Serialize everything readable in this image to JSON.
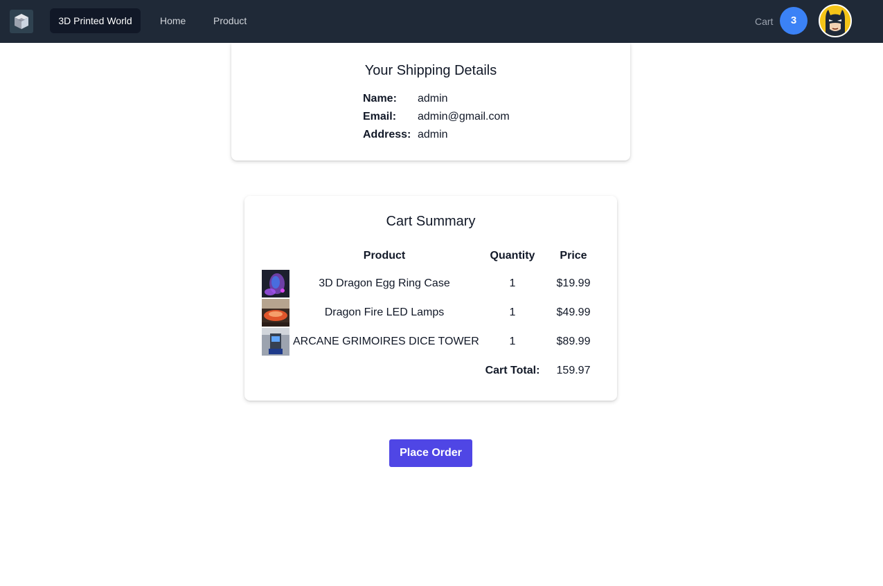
{
  "navbar": {
    "logo_icon": "cube-icon",
    "brand": "3D Printed World",
    "links": [
      "Home",
      "Product"
    ],
    "cart_label": "Cart",
    "cart_count": "3",
    "avatar_icon": "batman-avatar"
  },
  "shipping": {
    "title": "Your Shipping Details",
    "rows": [
      {
        "key": "Name:",
        "value": "admin"
      },
      {
        "key": "Email:",
        "value": "admin@gmail.com"
      },
      {
        "key": "Address:",
        "value": "admin"
      }
    ]
  },
  "cart": {
    "title": "Cart Summary",
    "headers": {
      "product": "Product",
      "quantity": "Quantity",
      "price": "Price"
    },
    "items": [
      {
        "name": "3D Dragon Egg Ring Case",
        "quantity": "1",
        "price": "$19.99"
      },
      {
        "name": "Dragon Fire LED Lamps",
        "quantity": "1",
        "price": "$49.99"
      },
      {
        "name": "ARCANE GRIMOIRES DICE TOWER",
        "quantity": "1",
        "price": "$89.99"
      }
    ],
    "total_label": "Cart Total:",
    "total_value": "159.97"
  },
  "place_order_label": "Place Order",
  "colors": {
    "navbar_bg": "#1f2937",
    "badge": "#3b82f6",
    "primary_button": "#4f46e5"
  }
}
